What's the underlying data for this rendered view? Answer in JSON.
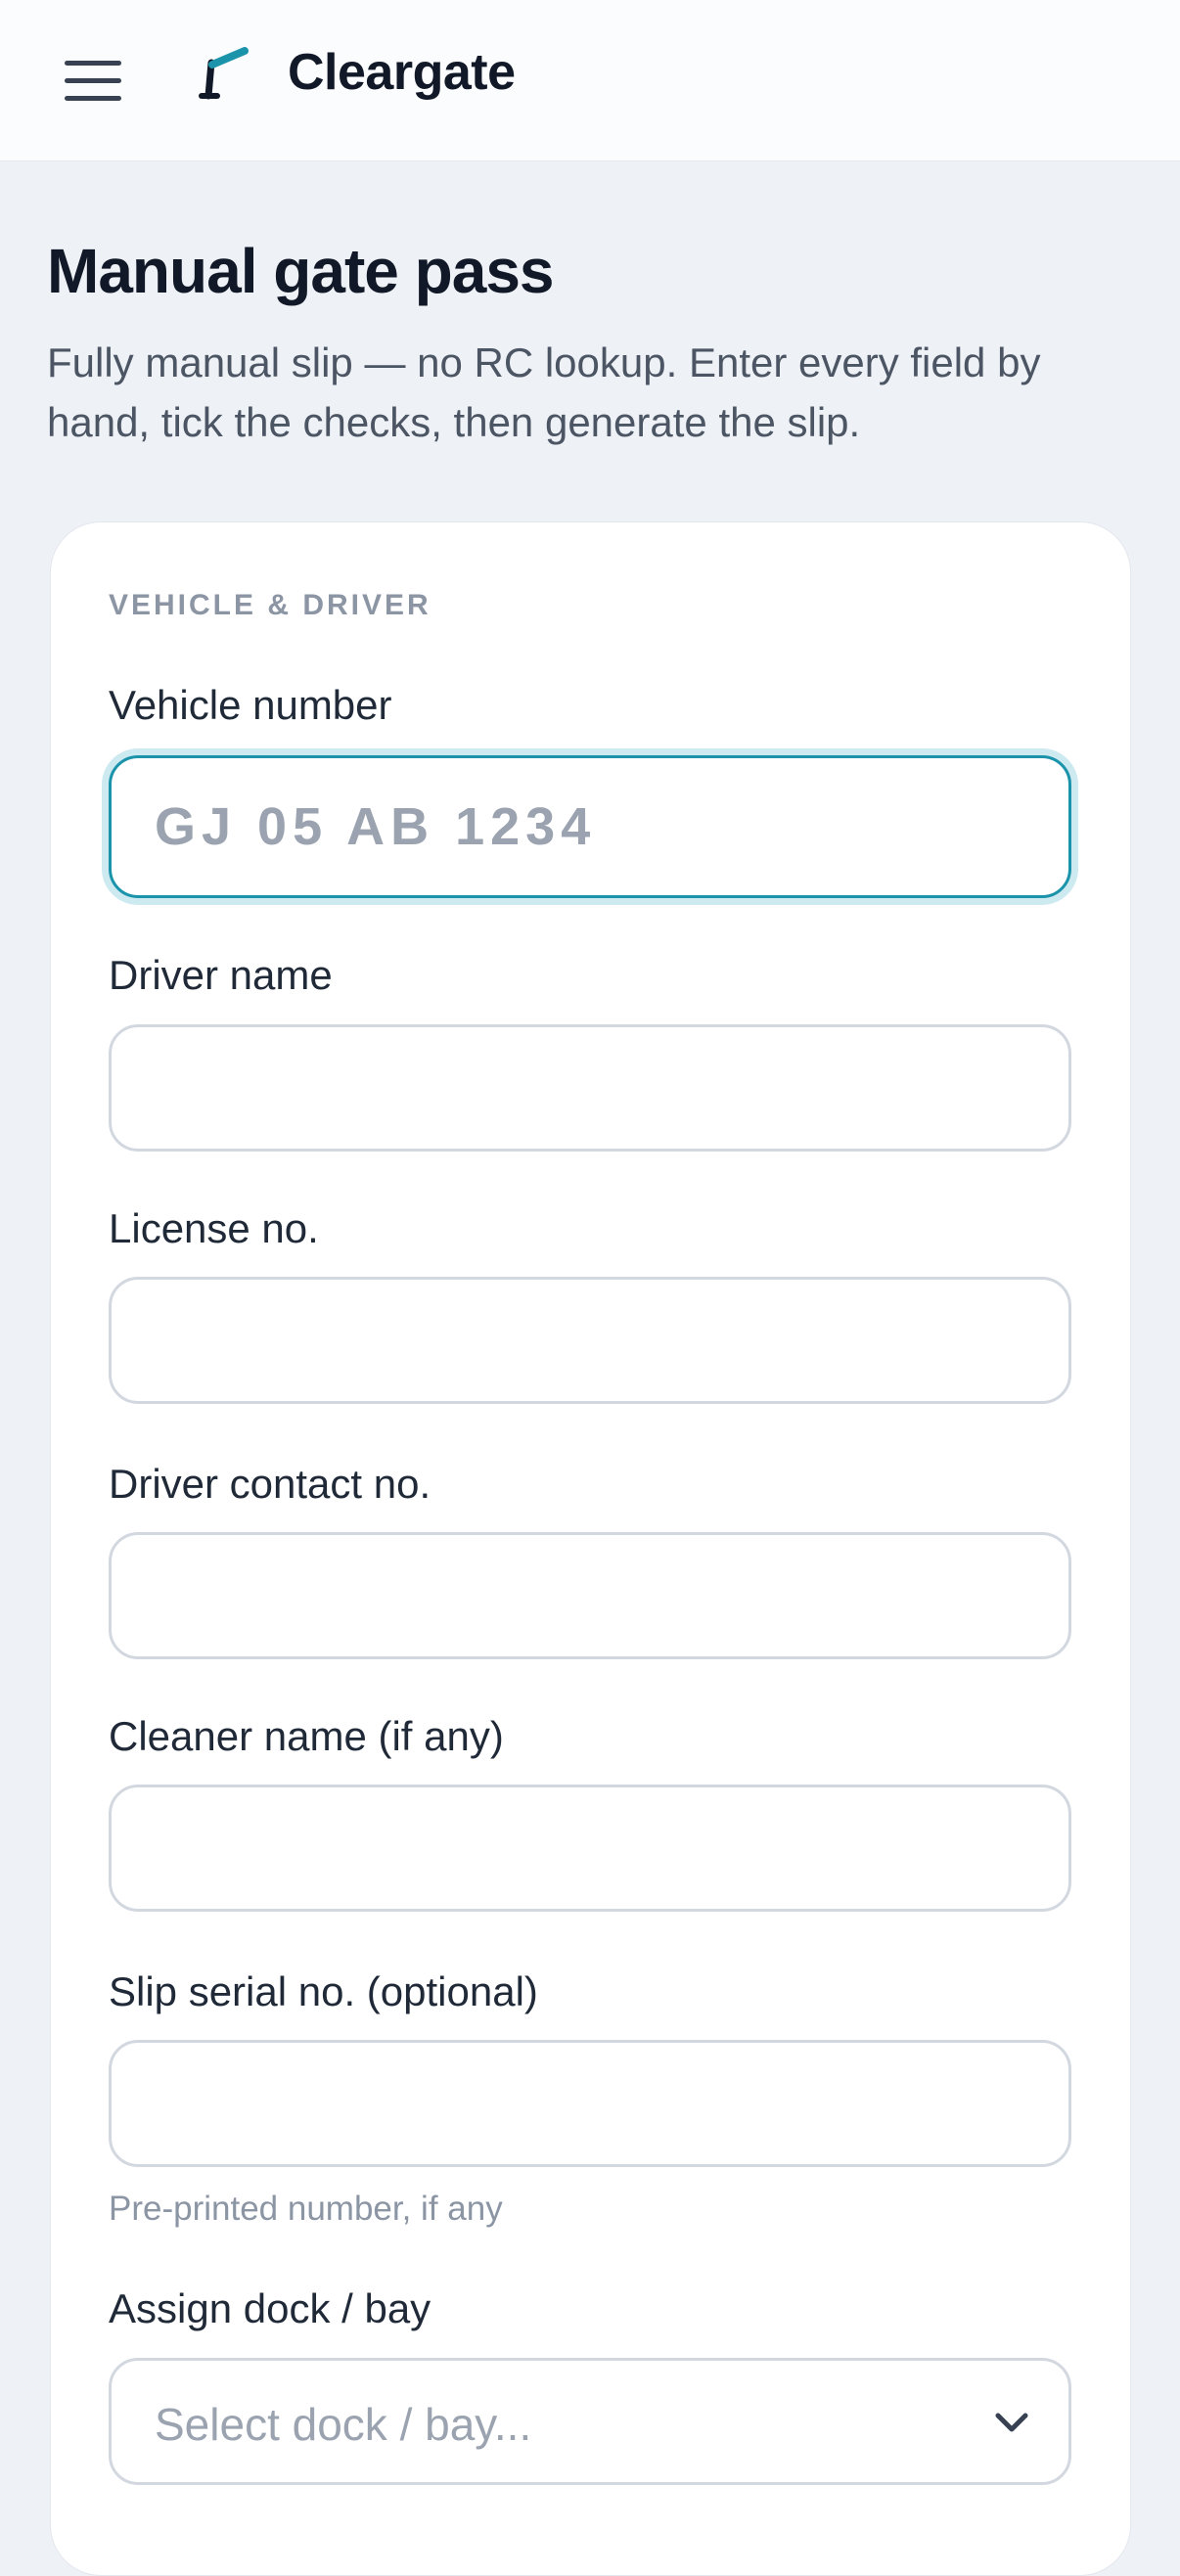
{
  "header": {
    "brand": "Cleargate",
    "menu_icon": "hamburger-menu-icon",
    "logo_icon": "gate-barrier-icon",
    "accent_color": "#1b93ab"
  },
  "page": {
    "title": "Manual gate pass",
    "subtitle": "Fully manual slip — no RC lookup. Enter every field by hand, tick the checks, then generate the slip."
  },
  "form": {
    "section_title": "VEHICLE & DRIVER",
    "vehicle_number": {
      "label": "Vehicle number",
      "placeholder": "GJ 05 AB 1234",
      "value": ""
    },
    "driver_name": {
      "label": "Driver name",
      "value": ""
    },
    "license_no": {
      "label": "License no.",
      "value": ""
    },
    "driver_contact": {
      "label": "Driver contact no.",
      "value": ""
    },
    "cleaner_name": {
      "label": "Cleaner name (if any)",
      "value": ""
    },
    "slip_serial": {
      "label": "Slip serial no. (optional)",
      "value": "",
      "help": "Pre-printed number, if any"
    },
    "dock": {
      "label": "Assign dock / bay",
      "placeholder": "Select dock / bay...",
      "icon": "chevron-down-icon"
    }
  }
}
